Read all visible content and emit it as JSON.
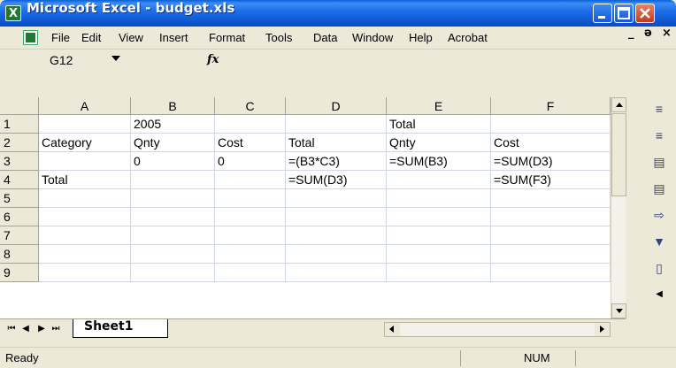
{
  "window": {
    "title": "Microsoft Excel - budget.xls"
  },
  "menubar": {
    "items": [
      "File",
      "Edit",
      "View",
      "Insert",
      "Format",
      "Tools",
      "Data",
      "Window",
      "Help",
      "Acrobat"
    ],
    "right_minimize": "_",
    "right_restore": "ə",
    "right_close": "×"
  },
  "formula": {
    "namebox_value": "G12",
    "fx_label": "fx",
    "value": ""
  },
  "grid": {
    "columns": [
      "A",
      "B",
      "C",
      "D",
      "E",
      "F"
    ],
    "rows": [
      {
        "num": "1",
        "cells": [
          "",
          "2005",
          "",
          "",
          "Total",
          ""
        ]
      },
      {
        "num": "2",
        "cells": [
          "Category",
          "Qnty",
          "Cost",
          "Total",
          "Qnty",
          "Cost"
        ]
      },
      {
        "num": "3",
        "cells": [
          "",
          "0",
          "0",
          "=(B3*C3)",
          "=SUM(B3)",
          "=SUM(D3)"
        ]
      },
      {
        "num": "4",
        "cells": [
          "Total",
          "",
          "",
          "=SUM(D3)",
          "",
          "=SUM(F3)"
        ]
      },
      {
        "num": "5",
        "cells": [
          "",
          "",
          "",
          "",
          "",
          ""
        ]
      },
      {
        "num": "6",
        "cells": [
          "",
          "",
          "",
          "",
          "",
          ""
        ]
      },
      {
        "num": "7",
        "cells": [
          "",
          "",
          "",
          "",
          "",
          ""
        ]
      },
      {
        "num": "8",
        "cells": [
          "",
          "",
          "",
          "",
          "",
          ""
        ]
      },
      {
        "num": "9",
        "cells": [
          "",
          "",
          "",
          "",
          "",
          ""
        ]
      }
    ]
  },
  "sheets": {
    "tabs": [
      "Sheet1"
    ]
  },
  "status": {
    "left": "Ready",
    "num": "NUM"
  },
  "colors": {
    "titlebar": "#0b55cf",
    "chrome": "#ece9d8",
    "gridline": "#d0d7e5"
  }
}
